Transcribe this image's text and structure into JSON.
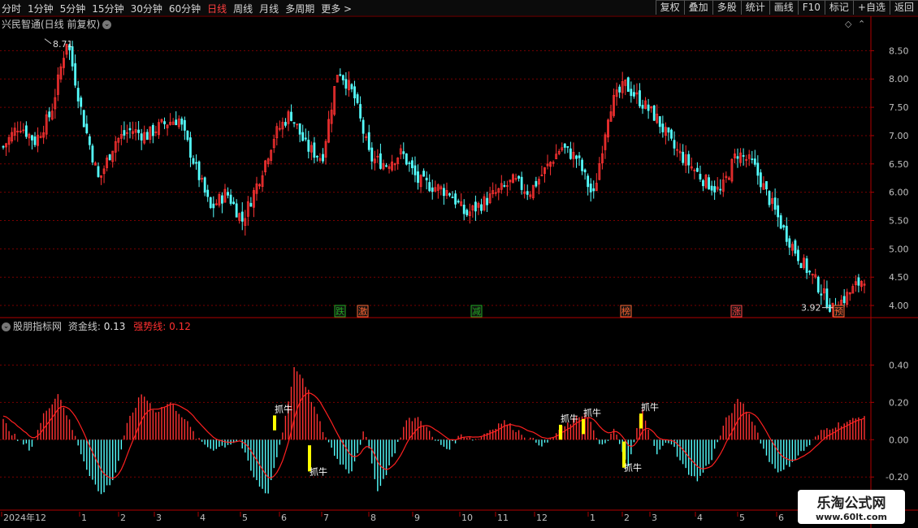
{
  "toolbar": {
    "periods": [
      "分时",
      "1分钟",
      "5分钟",
      "15分钟",
      "30分钟",
      "60分钟",
      "日线",
      "周线",
      "月线",
      "多周期",
      "更多 >"
    ],
    "active_period": "日线",
    "buttons": [
      "复权",
      "叠加",
      "多股",
      "统计",
      "画线",
      "F10",
      "标记",
      "+自选",
      "返回"
    ]
  },
  "pane1": {
    "title": "兴民智通(日线 前复权)",
    "high_label": "8.71",
    "low_label": "3.92",
    "markers": [
      {
        "text": "跌",
        "color": "#22aa22"
      },
      {
        "text": "激",
        "color": "#ff6633"
      },
      {
        "text": "减",
        "color": "#22aa22"
      },
      {
        "text": "榜",
        "color": "#ff6633"
      },
      {
        "text": "涨",
        "color": "#ff4444"
      },
      {
        "text": "预",
        "color": "#ff6633"
      }
    ]
  },
  "pane2": {
    "indicator_name": "股朋指标网",
    "line1_label": "资金线:",
    "line1_value": "0.13",
    "line2_label": "强势线:",
    "line2_value": "0.12",
    "signal_text": "抓牛"
  },
  "colors": {
    "up": "#ff3232",
    "down": "#54ffff",
    "grid": "#7a0000",
    "axis_text": "#c0c0c0",
    "strong_line": "#ff2020",
    "signal_bar": "#ffff00"
  },
  "watermark": {
    "title": "乐淘公式网",
    "url": "www.60lt.com"
  },
  "chart_data": [
    {
      "type": "candlestick",
      "title": "兴民智通(日线 前复权)",
      "y_ticks": [
        "8.50",
        "8.00",
        "7.50",
        "7.00",
        "6.50",
        "6.00",
        "5.50",
        "5.00",
        "4.50",
        "4.00"
      ],
      "ylim": [
        3.8,
        8.85
      ],
      "x_labels": [
        "2024年12",
        "1",
        "2",
        "3",
        "4",
        "5",
        "6",
        "7",
        "8",
        "9",
        "10",
        "11",
        "12",
        "1",
        "2",
        "3",
        "4",
        "5",
        "6"
      ],
      "approx_close_path": [
        6.8,
        7.2,
        6.9,
        7.4,
        8.71,
        7.3,
        6.2,
        6.9,
        7.1,
        7.0,
        7.2,
        7.3,
        6.5,
        5.7,
        6.0,
        5.5,
        6.2,
        7.0,
        7.4,
        6.8,
        6.6,
        8.2,
        7.7,
        6.6,
        6.5,
        6.7,
        6.2,
        6.1,
        6.0,
        5.6,
        5.8,
        6.0,
        6.2,
        6.0,
        6.4,
        6.8,
        6.6,
        5.9,
        7.5,
        7.9,
        7.6,
        7.3,
        6.8,
        6.5,
        6.2,
        6.0,
        6.7,
        6.5,
        5.9,
        5.3,
        4.8,
        4.4,
        3.92,
        4.2,
        4.5
      ]
    },
    {
      "type": "bar",
      "title": "股朋指标网",
      "y_ticks": [
        "0.40",
        "0.20",
        "0.00",
        "-0.20"
      ],
      "ylim": [
        -0.36,
        0.58
      ],
      "series": [
        {
          "name": "资金线",
          "last": 0.13
        },
        {
          "name": "强势线",
          "last": 0.12
        }
      ],
      "approx_path": [
        0.1,
        0.0,
        -0.05,
        0.15,
        0.25,
        0.05,
        -0.15,
        -0.3,
        -0.2,
        0.1,
        0.25,
        0.15,
        0.2,
        0.12,
        0.0,
        -0.05,
        -0.03,
        0.0,
        -0.2,
        -0.3,
        0.0,
        0.4,
        0.25,
        0.05,
        -0.1,
        -0.18,
        0.05,
        -0.28,
        -0.1,
        0.1,
        0.12,
        0.0,
        -0.05,
        0.03,
        0.0,
        0.05,
        0.1,
        0.05,
        0.0,
        -0.03,
        0.05,
        0.1,
        0.15,
        -0.05,
        0.05,
        -0.15,
        0.18,
        -0.08,
        0.0,
        -0.15,
        -0.22,
        -0.1,
        0.1,
        0.22,
        0.1,
        -0.1,
        -0.18,
        -0.1,
        -0.03,
        0.05,
        0.08,
        0.1,
        0.13
      ]
    }
  ]
}
